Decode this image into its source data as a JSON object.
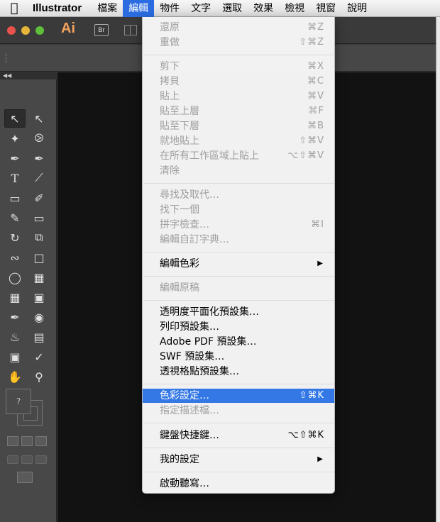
{
  "menubar": {
    "app_name": "Illustrator",
    "items": [
      "檔案",
      "編輯",
      "物件",
      "文字",
      "選取",
      "效果",
      "檢視",
      "視窗",
      "說明"
    ],
    "active_item": "編輯"
  },
  "titlebar": {
    "app_logo": "Ai",
    "bridge_label": "Br"
  },
  "toolbox": {
    "fill_box_glyph": "?"
  },
  "edit_menu": {
    "undo": {
      "label": "還原",
      "shortcut": "⌘Z"
    },
    "redo": {
      "label": "重做",
      "shortcut": "⇧⌘Z"
    },
    "cut": {
      "label": "剪下",
      "shortcut": "⌘X"
    },
    "copy": {
      "label": "拷貝",
      "shortcut": "⌘C"
    },
    "paste": {
      "label": "貼上",
      "shortcut": "⌘V"
    },
    "paste_in_front": {
      "label": "貼至上層",
      "shortcut": "⌘F"
    },
    "paste_in_back": {
      "label": "貼至下層",
      "shortcut": "⌘B"
    },
    "paste_in_place": {
      "label": "就地貼上",
      "shortcut": "⇧⌘V"
    },
    "paste_all_artboards": {
      "label": "在所有工作區域上貼上",
      "shortcut": "⌥⇧⌘V"
    },
    "clear": {
      "label": "清除"
    },
    "find_replace": {
      "label": "尋找及取代…"
    },
    "find_next": {
      "label": "找下一個"
    },
    "spell_check": {
      "label": "拼字檢查…",
      "shortcut": "⌘I"
    },
    "edit_dictionary": {
      "label": "編輯自訂字典…"
    },
    "edit_colors": {
      "label": "編輯色彩"
    },
    "edit_original": {
      "label": "編輯原稿"
    },
    "transparency_presets": {
      "label": "透明度平面化預設集…"
    },
    "print_presets": {
      "label": "列印預設集…"
    },
    "pdf_presets": {
      "label": "Adobe PDF 預設集…"
    },
    "swf_presets": {
      "label": "SWF 預設集…"
    },
    "perspective_grid_presets": {
      "label": "透視格點預設集…"
    },
    "color_settings": {
      "label": "色彩設定…",
      "shortcut": "⇧⌘K"
    },
    "assign_profile": {
      "label": "指定描述檔…"
    },
    "keyboard_shortcuts": {
      "label": "鍵盤快捷鍵…",
      "shortcut": "⌥⇧⌘K"
    },
    "my_settings": {
      "label": "我的設定"
    },
    "start_dictation": {
      "label": "啟動聽寫…"
    }
  }
}
